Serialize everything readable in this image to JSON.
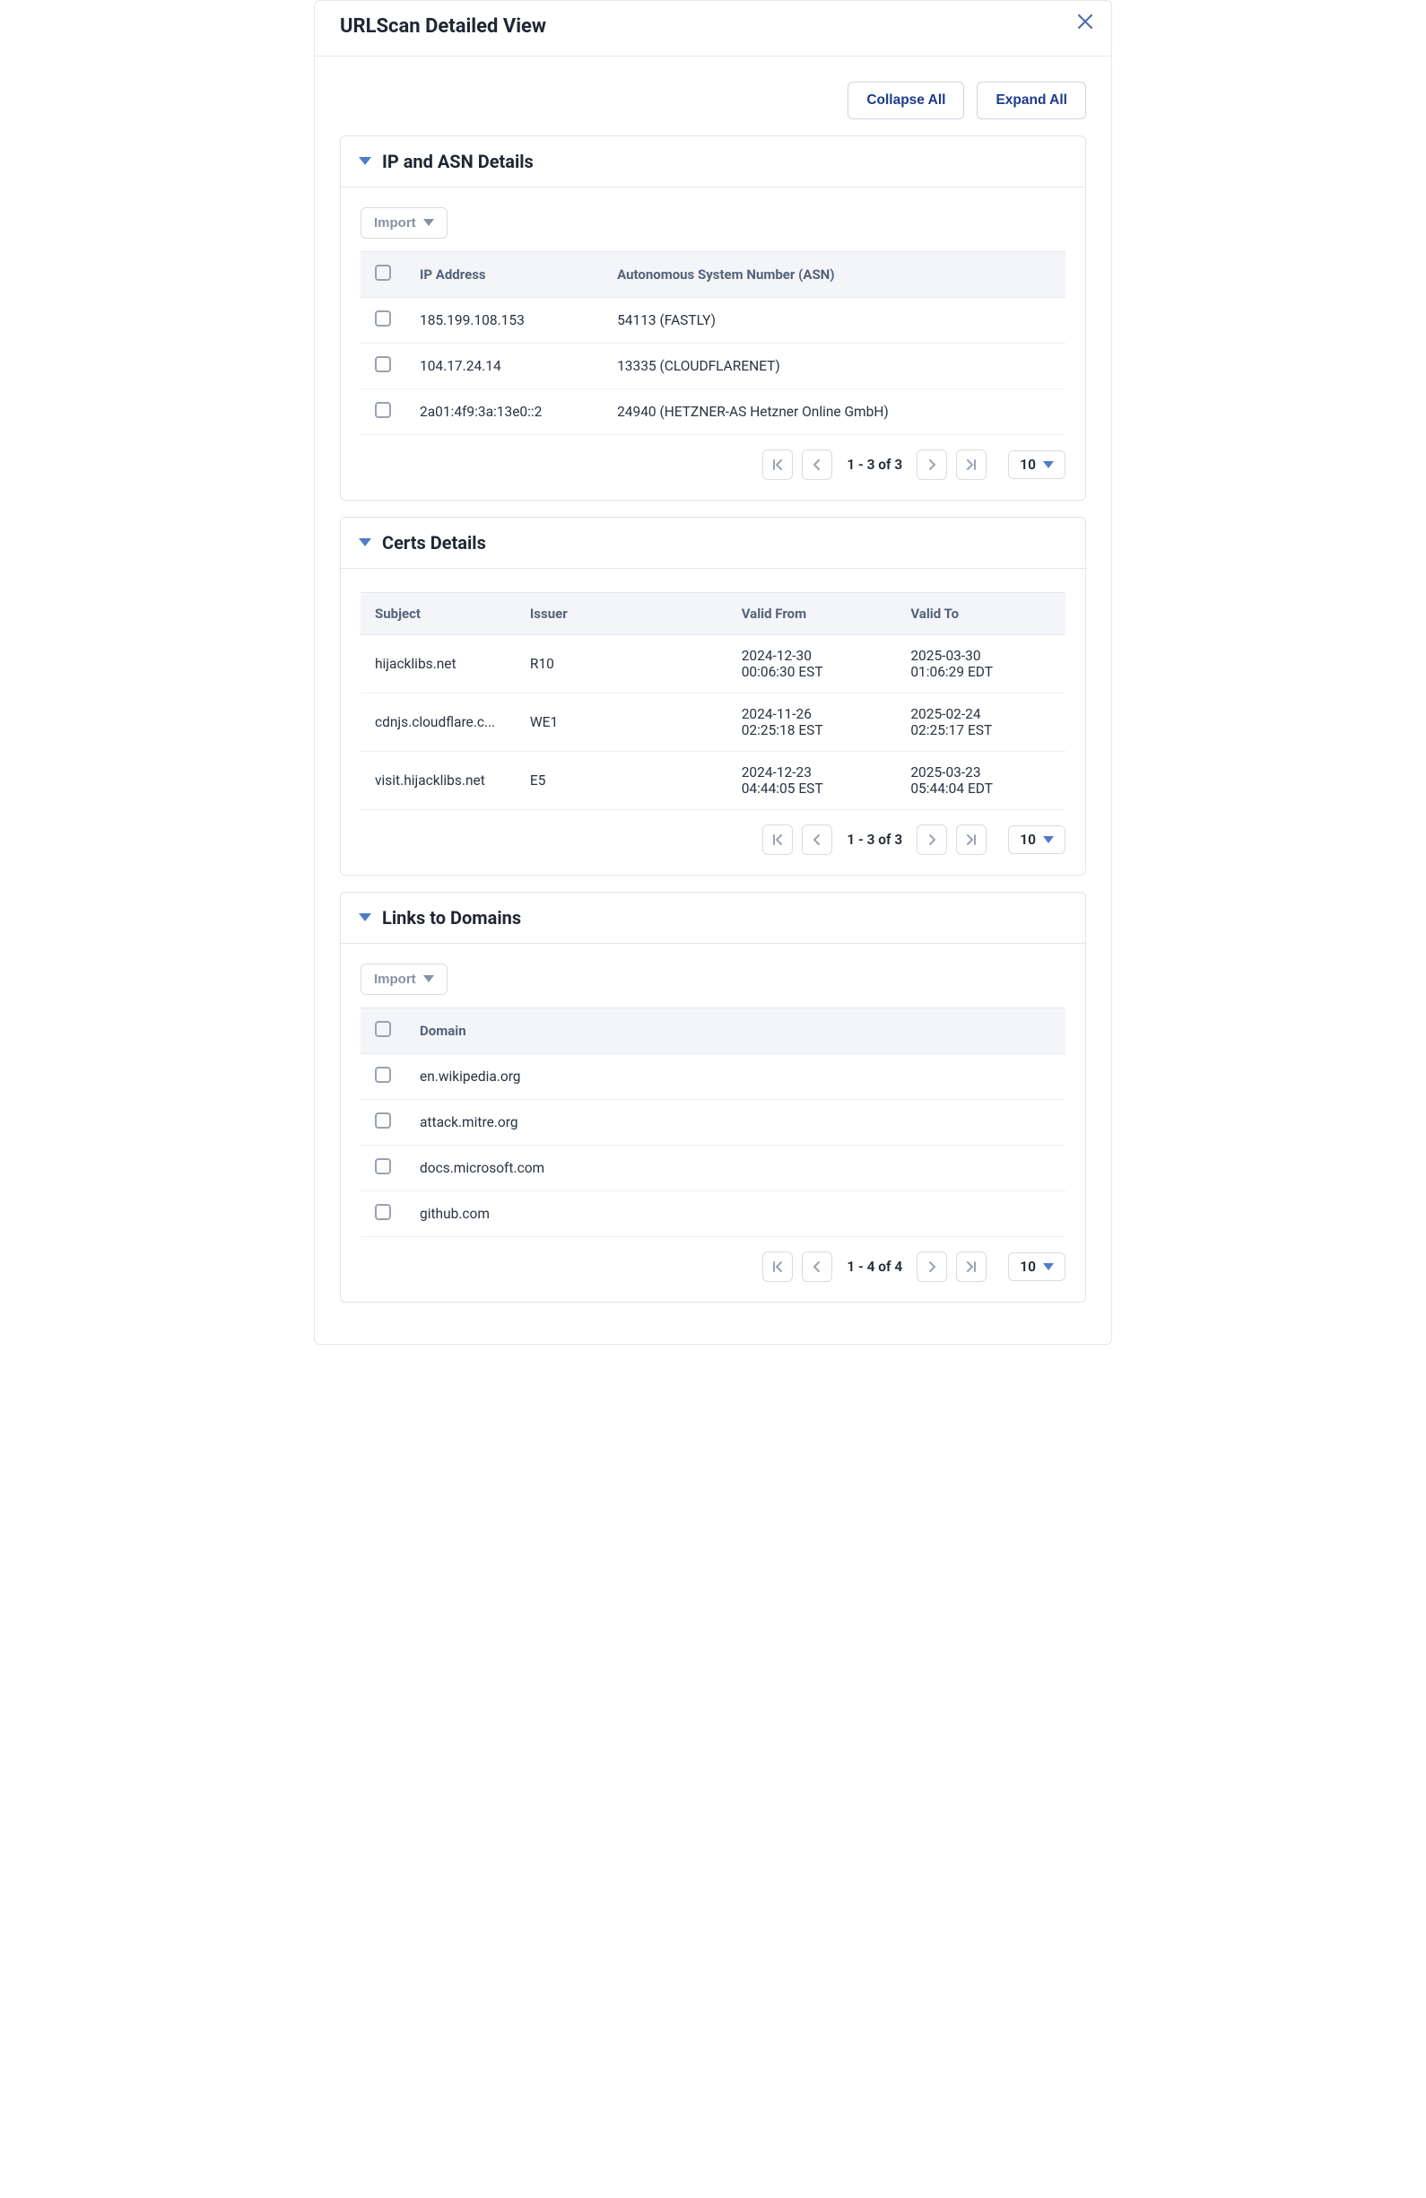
{
  "modal": {
    "title": "URLScan Detailed View"
  },
  "actions": {
    "collapse_all": "Collapse All",
    "expand_all": "Expand All"
  },
  "ip_asn": {
    "title": "IP and ASN Details",
    "import_label": "Import",
    "columns": {
      "ip": "IP Address",
      "asn": "Autonomous System Number (ASN)"
    },
    "rows": [
      {
        "ip": "185.199.108.153",
        "asn": "54113 (FASTLY)"
      },
      {
        "ip": "104.17.24.14",
        "asn": "13335 (CLOUDFLARENET)"
      },
      {
        "ip": "2a01:4f9:3a:13e0::2",
        "asn": "24940 (HETZNER-AS Hetzner Online GmbH)"
      }
    ],
    "pager": {
      "text": "1 - 3 of 3",
      "page_size": "10"
    }
  },
  "certs": {
    "title": "Certs Details",
    "columns": {
      "subject": "Subject",
      "issuer": "Issuer",
      "valid_from": "Valid From",
      "valid_to": "Valid To"
    },
    "rows": [
      {
        "subject": "hijacklibs.net",
        "issuer": "R10",
        "from1": "2024-12-30",
        "from2": "00:06:30 EST",
        "to1": "2025-03-30",
        "to2": "01:06:29 EDT"
      },
      {
        "subject": "cdnjs.cloudflare.c...",
        "issuer": "WE1",
        "from1": "2024-11-26",
        "from2": "02:25:18 EST",
        "to1": "2025-02-24",
        "to2": "02:25:17 EST"
      },
      {
        "subject": "visit.hijacklibs.net",
        "issuer": "E5",
        "from1": "2024-12-23",
        "from2": "04:44:05 EST",
        "to1": "2025-03-23",
        "to2": "05:44:04 EDT"
      }
    ],
    "pager": {
      "text": "1 - 3 of 3",
      "page_size": "10"
    }
  },
  "links": {
    "title": "Links to Domains",
    "import_label": "Import",
    "columns": {
      "domain": "Domain"
    },
    "rows": [
      {
        "domain": "en.wikipedia.org"
      },
      {
        "domain": "attack.mitre.org"
      },
      {
        "domain": "docs.microsoft.com"
      },
      {
        "domain": "github.com"
      }
    ],
    "pager": {
      "text": "1 - 4 of 4",
      "page_size": "10"
    }
  }
}
